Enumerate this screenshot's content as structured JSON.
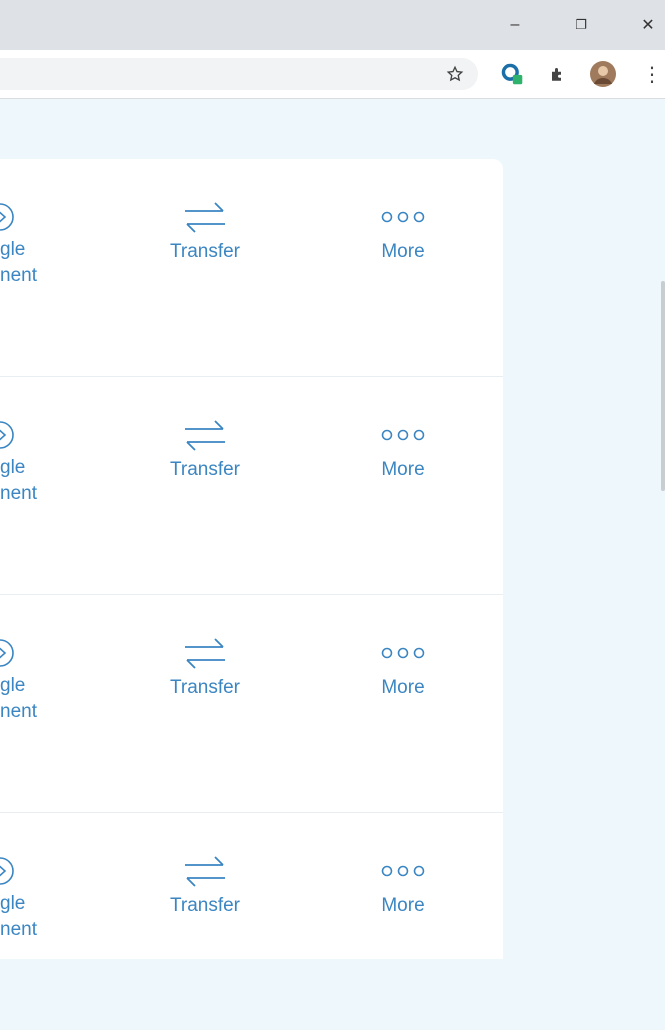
{
  "window": {
    "minimize_glyph": "–",
    "restore_glyph": "❐",
    "close_glyph": "✕"
  },
  "toolbar": {
    "bookmark_icon": "star-icon",
    "extension_icon": "puzzle-icon",
    "menu_glyph": "⋮"
  },
  "rows": [
    {
      "partial_label_1": "gle",
      "partial_label_2": "nent",
      "transfer_label": "Transfer",
      "more_label": "More"
    },
    {
      "partial_label_1": "gle",
      "partial_label_2": "nent",
      "transfer_label": "Transfer",
      "more_label": "More"
    },
    {
      "partial_label_1": "gle",
      "partial_label_2": "nent",
      "transfer_label": "Transfer",
      "more_label": "More"
    },
    {
      "partial_label_1": "gle",
      "partial_label_2": "nent",
      "transfer_label": "Transfer",
      "more_label": "More"
    }
  ],
  "colors": {
    "accent": "#3b86c2",
    "page_bg": "#eef7fc",
    "titlebar_bg": "#dee1e6"
  }
}
